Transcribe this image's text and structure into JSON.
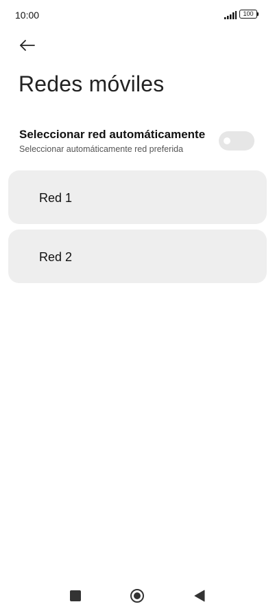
{
  "status_bar": {
    "time": "10:00",
    "battery": "100"
  },
  "header": {
    "back_icon": "arrow-left-icon",
    "title": "Redes móviles"
  },
  "auto_select": {
    "title": "Seleccionar red automáticamente",
    "subtitle": "Seleccionar automáticamente red preferida",
    "enabled": false
  },
  "networks": [
    {
      "label": "Red 1"
    },
    {
      "label": "Red 2"
    }
  ],
  "nav_bar": {
    "recents_icon": "square-icon",
    "home_icon": "circle-icon",
    "back_icon": "triangle-back-icon"
  },
  "colors": {
    "card_background": "#eeeeee",
    "toggle_off": "#e6e6e6"
  }
}
